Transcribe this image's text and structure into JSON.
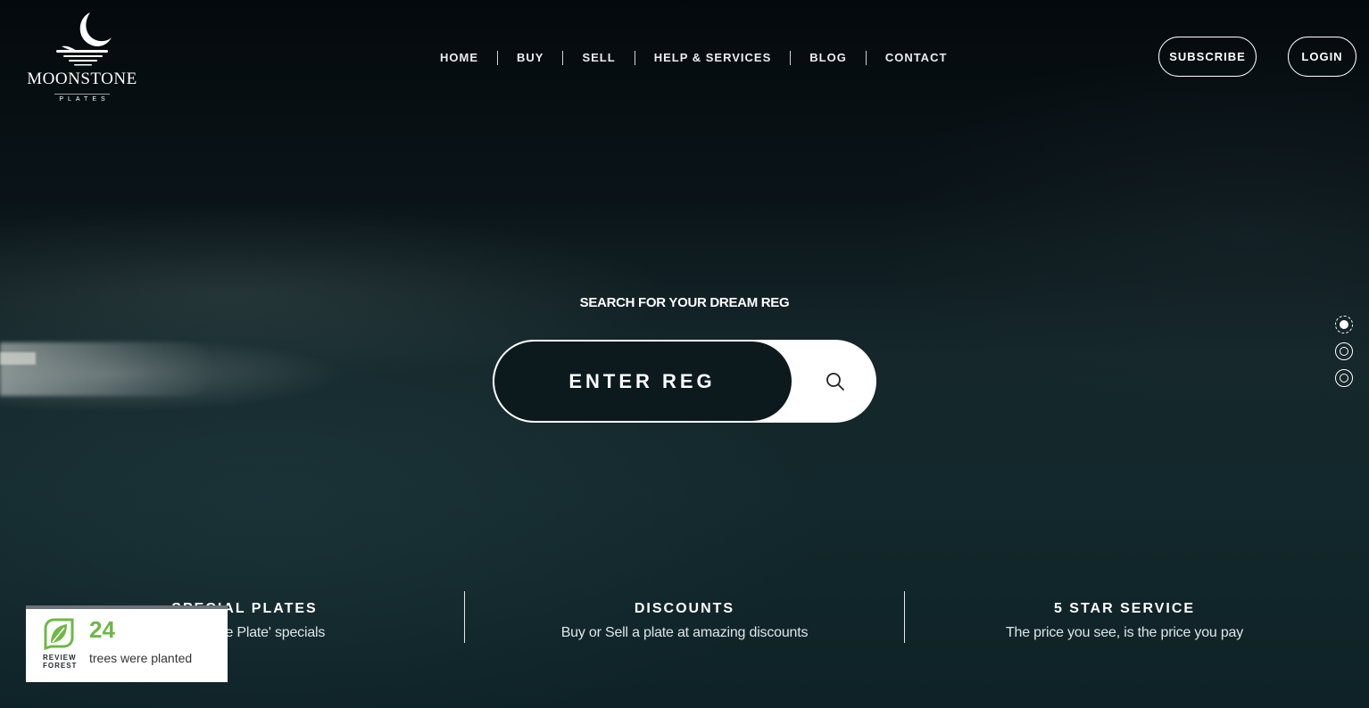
{
  "logo": {
    "name": "MOONSTONE",
    "sub": "PLATES"
  },
  "nav": {
    "items": [
      "HOME",
      "BUY",
      "SELL",
      "HELP & SERVICES",
      "BLOG",
      "CONTACT"
    ]
  },
  "header_buttons": {
    "subscribe": "SUBSCRIBE",
    "login": "LOGIN"
  },
  "search": {
    "heading": "SEARCH FOR YOUR DREAM REG",
    "placeholder": "ENTER REG",
    "icon": "search-icon"
  },
  "slider": {
    "count": 3,
    "active_index": 0
  },
  "features": [
    {
      "title": "SPECIAL PLATES",
      "desc": "Moonstone Plate' specials"
    },
    {
      "title": "DISCOUNTS",
      "desc": "Buy or Sell a plate at amazing discounts"
    },
    {
      "title": "5 STAR SERVICE",
      "desc": "The price you see, is the price you pay"
    }
  ],
  "review_forest": {
    "label_line1": "REVIEW",
    "label_line2": "FOREST",
    "count": "24",
    "caption": "trees were planted",
    "accent": "#6db845"
  }
}
